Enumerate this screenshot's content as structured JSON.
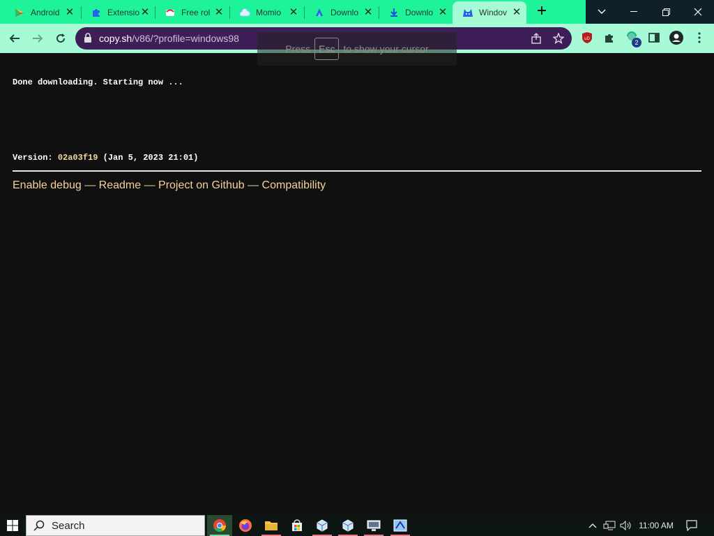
{
  "browser": {
    "tabs": [
      {
        "title": "Android",
        "icon": "play-store-icon",
        "active": false
      },
      {
        "title": "Extensio",
        "icon": "puzzle-icon",
        "active": false
      },
      {
        "title": "Free rol",
        "icon": "roll-icon",
        "active": false
      },
      {
        "title": "Momio",
        "icon": "cloud-icon",
        "active": false
      },
      {
        "title": "Downlo",
        "icon": "download-site-icon",
        "active": false
      },
      {
        "title": "Downlo",
        "icon": "download-arrow-icon",
        "active": false
      },
      {
        "title": "Windov",
        "icon": "v86-icon",
        "active": true
      }
    ],
    "url_host": "copy.sh",
    "url_path": "/v86/?profile=windows98",
    "profile_badge": "2",
    "ublock_label": "uD",
    "esc_hint": {
      "press": "Press",
      "key": "Esc",
      "rest": "to show your cursor"
    }
  },
  "page": {
    "log_line": "Done downloading. Starting now ...",
    "version_label": "Version: ",
    "version_hash": "02a03f19",
    "version_date": " (Jan 5, 2023 21:01)",
    "links": [
      "Enable debug",
      "Readme",
      "Project on Github",
      "Compatibility"
    ],
    "link_separator": " — "
  },
  "taskbar": {
    "search_placeholder": "Search",
    "time": "11:00 AM"
  },
  "colors": {
    "tabstrip": "#1ff39a",
    "toolbar": "#a6fbd6",
    "omnibox": "#3d1e56",
    "page_bg": "#101010",
    "link": "#f2d29a"
  }
}
